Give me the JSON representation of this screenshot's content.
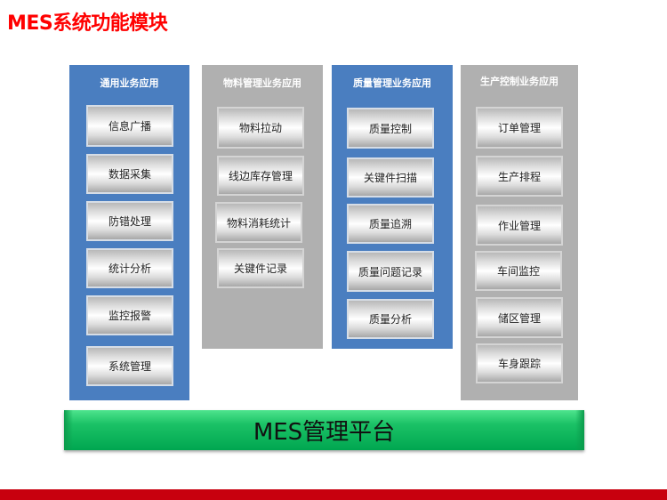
{
  "title": "MES系统功能模块",
  "panels": [
    {
      "title": "通用业务应用",
      "color": "#4a7ec0",
      "modules": [
        "信息广播",
        "数据采集",
        "防错处理",
        "统计分析",
        "监控报警",
        "系统管理"
      ]
    },
    {
      "title": "物料管理业务应用",
      "color": "#b0b0b0",
      "modules": [
        "物料拉动",
        "线边库存管理",
        "物料消耗统计",
        "关键件记录"
      ]
    },
    {
      "title": "质量管理业务应用",
      "color": "#4a7ec0",
      "modules": [
        "质量控制",
        "关键件扫描",
        "质量追溯",
        "质量问题记录",
        "质量分析"
      ]
    },
    {
      "title": "生产控制业务应用",
      "color": "#b0b0b0",
      "modules": [
        "订单管理",
        "生产排程",
        "作业管理",
        "车间监控",
        "储区管理",
        "车身跟踪"
      ]
    }
  ],
  "platform": {
    "label": "MES管理平台",
    "color": "#00b050"
  },
  "colors": {
    "title": "#ff0000",
    "footer_bar": "#c8000e"
  }
}
